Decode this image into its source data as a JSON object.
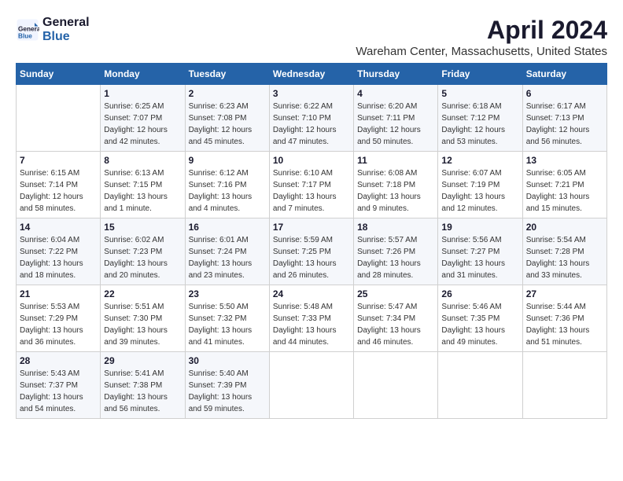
{
  "header": {
    "logo_line1": "General",
    "logo_line2": "Blue",
    "main_title": "April 2024",
    "subtitle": "Wareham Center, Massachusetts, United States"
  },
  "days_of_week": [
    "Sunday",
    "Monday",
    "Tuesday",
    "Wednesday",
    "Thursday",
    "Friday",
    "Saturday"
  ],
  "weeks": [
    [
      {
        "day": "",
        "info": ""
      },
      {
        "day": "1",
        "info": "Sunrise: 6:25 AM\nSunset: 7:07 PM\nDaylight: 12 hours\nand 42 minutes."
      },
      {
        "day": "2",
        "info": "Sunrise: 6:23 AM\nSunset: 7:08 PM\nDaylight: 12 hours\nand 45 minutes."
      },
      {
        "day": "3",
        "info": "Sunrise: 6:22 AM\nSunset: 7:10 PM\nDaylight: 12 hours\nand 47 minutes."
      },
      {
        "day": "4",
        "info": "Sunrise: 6:20 AM\nSunset: 7:11 PM\nDaylight: 12 hours\nand 50 minutes."
      },
      {
        "day": "5",
        "info": "Sunrise: 6:18 AM\nSunset: 7:12 PM\nDaylight: 12 hours\nand 53 minutes."
      },
      {
        "day": "6",
        "info": "Sunrise: 6:17 AM\nSunset: 7:13 PM\nDaylight: 12 hours\nand 56 minutes."
      }
    ],
    [
      {
        "day": "7",
        "info": "Sunrise: 6:15 AM\nSunset: 7:14 PM\nDaylight: 12 hours\nand 58 minutes."
      },
      {
        "day": "8",
        "info": "Sunrise: 6:13 AM\nSunset: 7:15 PM\nDaylight: 13 hours\nand 1 minute."
      },
      {
        "day": "9",
        "info": "Sunrise: 6:12 AM\nSunset: 7:16 PM\nDaylight: 13 hours\nand 4 minutes."
      },
      {
        "day": "10",
        "info": "Sunrise: 6:10 AM\nSunset: 7:17 PM\nDaylight: 13 hours\nand 7 minutes."
      },
      {
        "day": "11",
        "info": "Sunrise: 6:08 AM\nSunset: 7:18 PM\nDaylight: 13 hours\nand 9 minutes."
      },
      {
        "day": "12",
        "info": "Sunrise: 6:07 AM\nSunset: 7:19 PM\nDaylight: 13 hours\nand 12 minutes."
      },
      {
        "day": "13",
        "info": "Sunrise: 6:05 AM\nSunset: 7:21 PM\nDaylight: 13 hours\nand 15 minutes."
      }
    ],
    [
      {
        "day": "14",
        "info": "Sunrise: 6:04 AM\nSunset: 7:22 PM\nDaylight: 13 hours\nand 18 minutes."
      },
      {
        "day": "15",
        "info": "Sunrise: 6:02 AM\nSunset: 7:23 PM\nDaylight: 13 hours\nand 20 minutes."
      },
      {
        "day": "16",
        "info": "Sunrise: 6:01 AM\nSunset: 7:24 PM\nDaylight: 13 hours\nand 23 minutes."
      },
      {
        "day": "17",
        "info": "Sunrise: 5:59 AM\nSunset: 7:25 PM\nDaylight: 13 hours\nand 26 minutes."
      },
      {
        "day": "18",
        "info": "Sunrise: 5:57 AM\nSunset: 7:26 PM\nDaylight: 13 hours\nand 28 minutes."
      },
      {
        "day": "19",
        "info": "Sunrise: 5:56 AM\nSunset: 7:27 PM\nDaylight: 13 hours\nand 31 minutes."
      },
      {
        "day": "20",
        "info": "Sunrise: 5:54 AM\nSunset: 7:28 PM\nDaylight: 13 hours\nand 33 minutes."
      }
    ],
    [
      {
        "day": "21",
        "info": "Sunrise: 5:53 AM\nSunset: 7:29 PM\nDaylight: 13 hours\nand 36 minutes."
      },
      {
        "day": "22",
        "info": "Sunrise: 5:51 AM\nSunset: 7:30 PM\nDaylight: 13 hours\nand 39 minutes."
      },
      {
        "day": "23",
        "info": "Sunrise: 5:50 AM\nSunset: 7:32 PM\nDaylight: 13 hours\nand 41 minutes."
      },
      {
        "day": "24",
        "info": "Sunrise: 5:48 AM\nSunset: 7:33 PM\nDaylight: 13 hours\nand 44 minutes."
      },
      {
        "day": "25",
        "info": "Sunrise: 5:47 AM\nSunset: 7:34 PM\nDaylight: 13 hours\nand 46 minutes."
      },
      {
        "day": "26",
        "info": "Sunrise: 5:46 AM\nSunset: 7:35 PM\nDaylight: 13 hours\nand 49 minutes."
      },
      {
        "day": "27",
        "info": "Sunrise: 5:44 AM\nSunset: 7:36 PM\nDaylight: 13 hours\nand 51 minutes."
      }
    ],
    [
      {
        "day": "28",
        "info": "Sunrise: 5:43 AM\nSunset: 7:37 PM\nDaylight: 13 hours\nand 54 minutes."
      },
      {
        "day": "29",
        "info": "Sunrise: 5:41 AM\nSunset: 7:38 PM\nDaylight: 13 hours\nand 56 minutes."
      },
      {
        "day": "30",
        "info": "Sunrise: 5:40 AM\nSunset: 7:39 PM\nDaylight: 13 hours\nand 59 minutes."
      },
      {
        "day": "",
        "info": ""
      },
      {
        "day": "",
        "info": ""
      },
      {
        "day": "",
        "info": ""
      },
      {
        "day": "",
        "info": ""
      }
    ]
  ]
}
